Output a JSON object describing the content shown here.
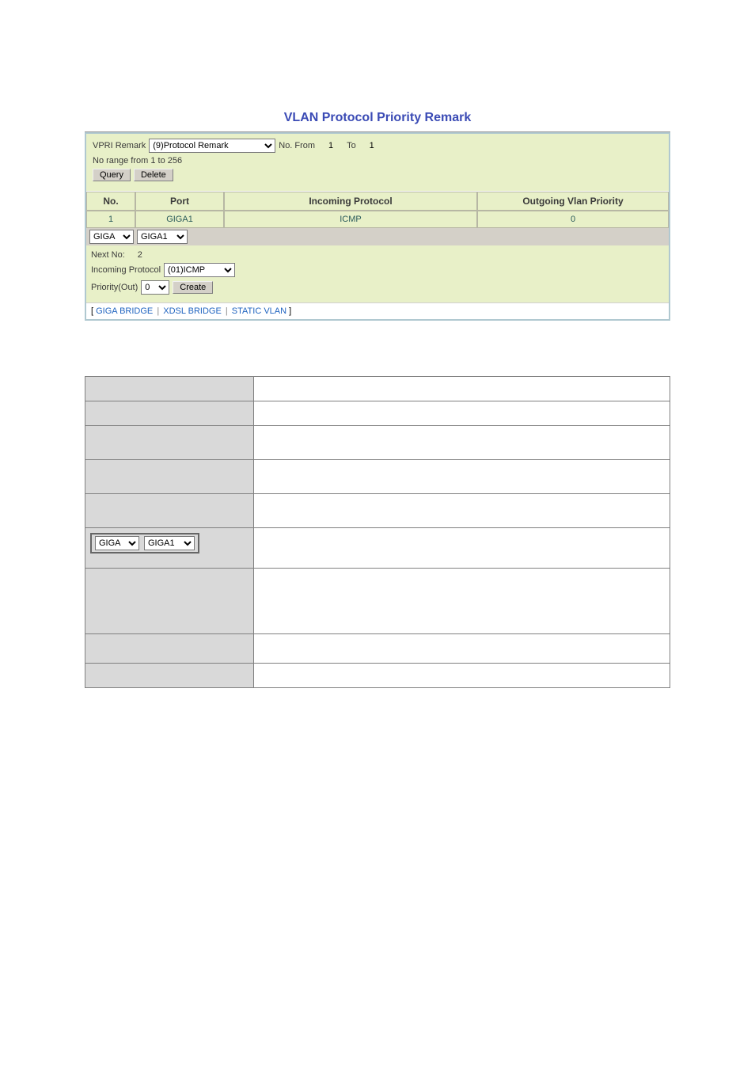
{
  "title": "VLAN Protocol Priority Remark",
  "filter": {
    "vpri_label": "VPRI Remark",
    "vpri_select": "(9)Protocol Remark",
    "no_from_label": "No. From",
    "no_from_value": "1",
    "to_label": "To",
    "to_value": "1",
    "range_hint": "No range from 1 to 256",
    "query_btn": "Query",
    "delete_btn": "Delete"
  },
  "headers": {
    "no": "No.",
    "port": "Port",
    "incoming": "Incoming Protocol",
    "outgoing": "Outgoing Vlan Priority"
  },
  "row": {
    "no": "1",
    "port": "GIGA1",
    "incoming": "ICMP",
    "outgoing": "0"
  },
  "filter2": {
    "sel1": "GIGA",
    "sel2": "GIGA1"
  },
  "lower": {
    "next_no_label": "Next No:",
    "next_no_value": "2",
    "incoming_label": "Incoming Protocol",
    "incoming_value": "(01)ICMP",
    "priority_label": "Priority(Out)",
    "priority_value": "0",
    "create_btn": "Create"
  },
  "links": {
    "open": "[ ",
    "giga": "GIGA BRIDGE",
    "xdsl": "XDSL BRIDGE",
    "static": "STATIC VLAN",
    "close": " ]",
    "sep": " | "
  },
  "ref_selects": {
    "sel1": "GIGA",
    "sel2": "GIGA1"
  }
}
